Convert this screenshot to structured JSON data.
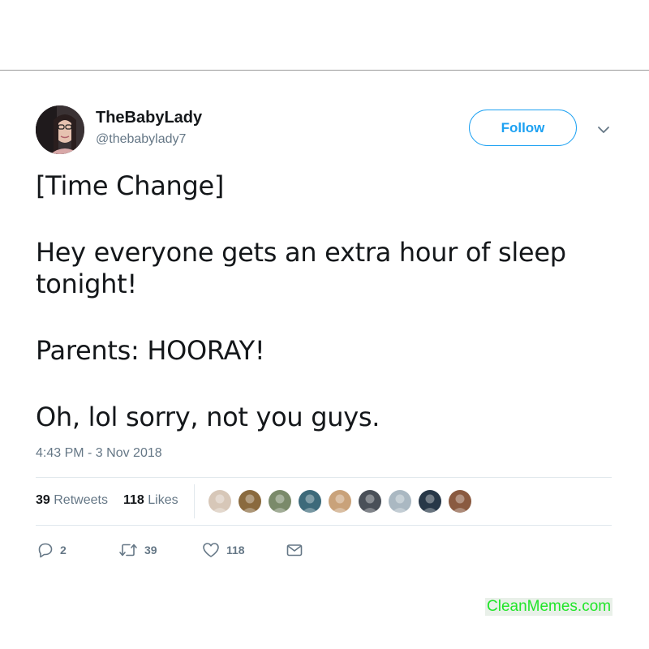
{
  "author": {
    "name": "TheBabyLady",
    "handle": "@thebabylady7"
  },
  "follow_button": {
    "label": "Follow"
  },
  "tweet": {
    "lines": [
      "[Time Change]",
      "Hey everyone gets an extra hour of sleep tonight!",
      "Parents: HOORAY!",
      "Oh, lol sorry, not you guys."
    ],
    "timestamp": "4:43 PM - 3 Nov 2018"
  },
  "stats": {
    "retweets_count": "39",
    "retweets_label": "Retweets",
    "likes_count": "118",
    "likes_label": "Likes"
  },
  "liker_avatar_colors": [
    "#d7c7b8",
    "#8a6a3e",
    "#7a8a6a",
    "#3d6a7a",
    "#c9a27a",
    "#4a5058",
    "#aab8c2",
    "#283848",
    "#8a5a40"
  ],
  "actions": {
    "reply_count": "2",
    "retweet_count": "39",
    "like_count": "118"
  },
  "watermark": "CleanMemes.com",
  "colors": {
    "accent": "#1da1f2",
    "secondary_text": "#657786",
    "watermark": "#22e52a"
  }
}
